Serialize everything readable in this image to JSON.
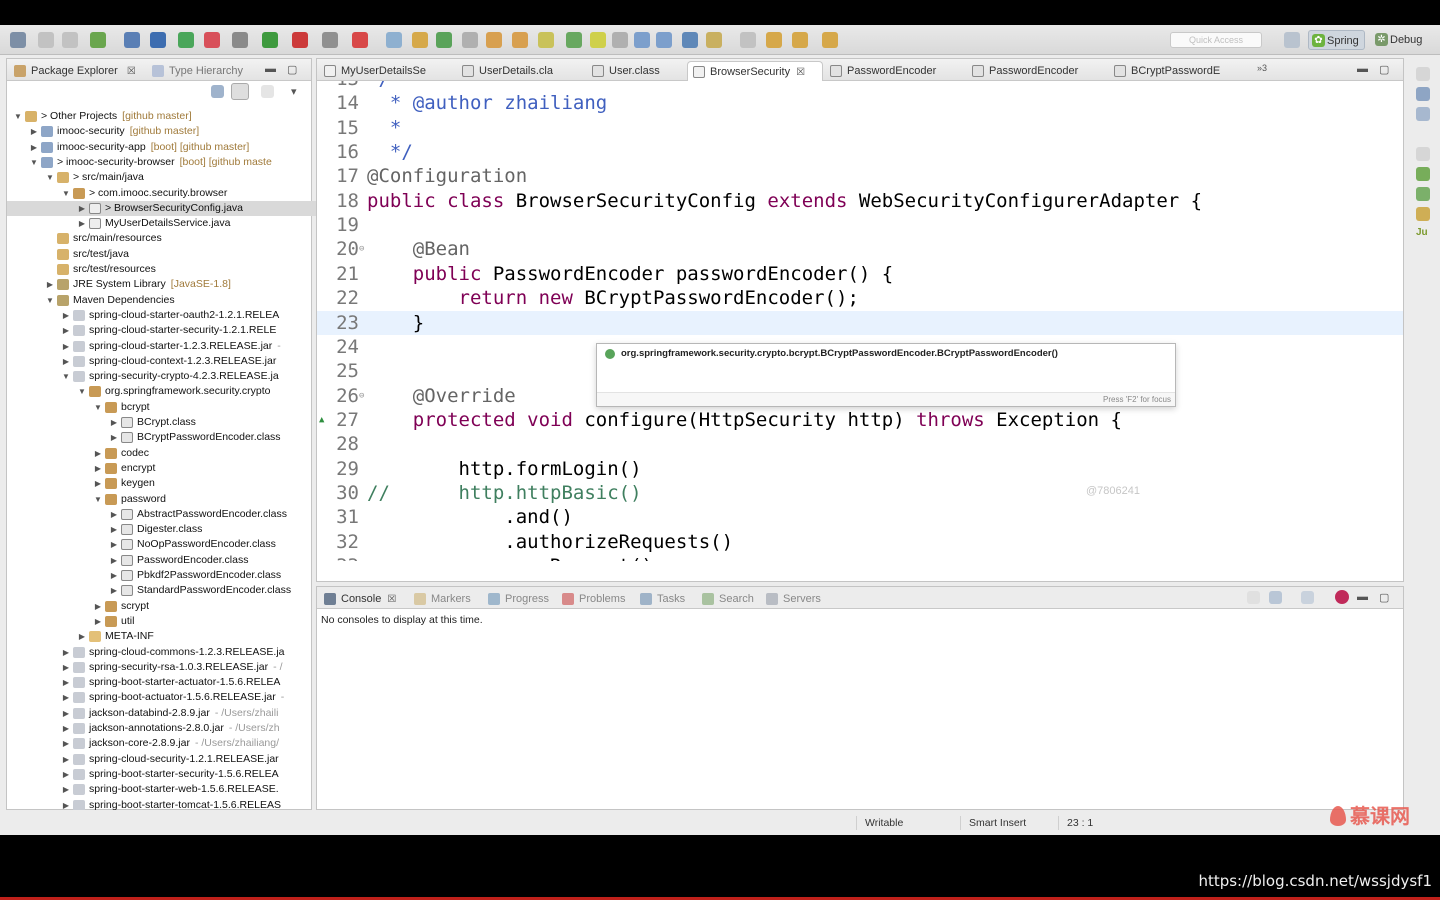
{
  "toolbar": {
    "quick_access_placeholder": "Quick Access",
    "perspectives": [
      {
        "label": "Spring",
        "icon": "spring-leaf-icon",
        "active": true
      },
      {
        "label": "Debug",
        "icon": "bug-icon",
        "active": false
      }
    ]
  },
  "explorer": {
    "tabs": [
      {
        "label": "Package Explorer",
        "active": true
      },
      {
        "label": "Type Hierarchy",
        "active": false
      }
    ],
    "tree": [
      {
        "depth": 0,
        "arrow": "open",
        "icon": "folder-set-icon",
        "label": "> Other Projects",
        "deco": "[github master]"
      },
      {
        "depth": 1,
        "arrow": "closed",
        "icon": "project-icon",
        "label": "imooc-security",
        "deco": "[github master]"
      },
      {
        "depth": 1,
        "arrow": "closed",
        "icon": "project-icon",
        "label": "imooc-security-app",
        "deco": "[boot] [github master]"
      },
      {
        "depth": 1,
        "arrow": "open",
        "icon": "project-icon",
        "label": "> imooc-security-browser",
        "deco": "[boot] [github maste"
      },
      {
        "depth": 2,
        "arrow": "open",
        "icon": "source-folder-icon",
        "label": "> src/main/java",
        "deco": ""
      },
      {
        "depth": 3,
        "arrow": "open",
        "icon": "package-icon",
        "label": "> com.imooc.security.browser",
        "deco": ""
      },
      {
        "depth": 4,
        "arrow": "closed",
        "icon": "java-file-icon",
        "label": "> BrowserSecurityConfig.java",
        "deco": "",
        "selected": true
      },
      {
        "depth": 4,
        "arrow": "closed",
        "icon": "java-file-icon",
        "label": "MyUserDetailsService.java",
        "deco": ""
      },
      {
        "depth": 2,
        "arrow": "none",
        "icon": "source-folder-icon",
        "label": "src/main/resources",
        "deco": ""
      },
      {
        "depth": 2,
        "arrow": "none",
        "icon": "source-folder-icon",
        "label": "src/test/java",
        "deco": ""
      },
      {
        "depth": 2,
        "arrow": "none",
        "icon": "source-folder-icon",
        "label": "src/test/resources",
        "deco": ""
      },
      {
        "depth": 2,
        "arrow": "closed",
        "icon": "library-icon",
        "label": "JRE System Library",
        "deco": "[JavaSE-1.8]"
      },
      {
        "depth": 2,
        "arrow": "open",
        "icon": "library-icon",
        "label": "Maven Dependencies",
        "deco": ""
      },
      {
        "depth": 3,
        "arrow": "closed",
        "icon": "jar-icon",
        "label": "spring-cloud-starter-oauth2-1.2.1.RELEA",
        "deco": ""
      },
      {
        "depth": 3,
        "arrow": "closed",
        "icon": "jar-icon",
        "label": "spring-cloud-starter-security-1.2.1.RELE",
        "deco": ""
      },
      {
        "depth": 3,
        "arrow": "closed",
        "icon": "jar-icon",
        "label": "spring-cloud-starter-1.2.3.RELEASE.jar",
        "deco": "-"
      },
      {
        "depth": 3,
        "arrow": "closed",
        "icon": "jar-icon",
        "label": "spring-cloud-context-1.2.3.RELEASE.jar",
        "deco": ""
      },
      {
        "depth": 3,
        "arrow": "open",
        "icon": "jar-icon",
        "label": "spring-security-crypto-4.2.3.RELEASE.ja",
        "deco": ""
      },
      {
        "depth": 4,
        "arrow": "open",
        "icon": "package-icon",
        "label": "org.springframework.security.crypto",
        "deco": ""
      },
      {
        "depth": 5,
        "arrow": "open",
        "icon": "package-icon",
        "label": "bcrypt",
        "deco": ""
      },
      {
        "depth": 6,
        "arrow": "closed",
        "icon": "class-file-icon",
        "label": "BCrypt.class",
        "deco": ""
      },
      {
        "depth": 6,
        "arrow": "closed",
        "icon": "class-file-icon",
        "label": "BCryptPasswordEncoder.class",
        "deco": ""
      },
      {
        "depth": 5,
        "arrow": "closed",
        "icon": "package-icon",
        "label": "codec",
        "deco": ""
      },
      {
        "depth": 5,
        "arrow": "closed",
        "icon": "package-icon",
        "label": "encrypt",
        "deco": ""
      },
      {
        "depth": 5,
        "arrow": "closed",
        "icon": "package-icon",
        "label": "keygen",
        "deco": ""
      },
      {
        "depth": 5,
        "arrow": "open",
        "icon": "package-icon",
        "label": "password",
        "deco": ""
      },
      {
        "depth": 6,
        "arrow": "closed",
        "icon": "class-file-icon",
        "label": "AbstractPasswordEncoder.class",
        "deco": ""
      },
      {
        "depth": 6,
        "arrow": "closed",
        "icon": "class-file-icon",
        "label": "Digester.class",
        "deco": ""
      },
      {
        "depth": 6,
        "arrow": "closed",
        "icon": "class-file-icon",
        "label": "NoOpPasswordEncoder.class",
        "deco": ""
      },
      {
        "depth": 6,
        "arrow": "closed",
        "icon": "class-file-icon",
        "label": "PasswordEncoder.class",
        "deco": ""
      },
      {
        "depth": 6,
        "arrow": "closed",
        "icon": "class-file-icon",
        "label": "Pbkdf2PasswordEncoder.class",
        "deco": ""
      },
      {
        "depth": 6,
        "arrow": "closed",
        "icon": "class-file-icon",
        "label": "StandardPasswordEncoder.class",
        "deco": ""
      },
      {
        "depth": 5,
        "arrow": "closed",
        "icon": "package-icon",
        "label": "scrypt",
        "deco": ""
      },
      {
        "depth": 5,
        "arrow": "closed",
        "icon": "package-icon",
        "label": "util",
        "deco": ""
      },
      {
        "depth": 4,
        "arrow": "closed",
        "icon": "folder-icon",
        "label": "META-INF",
        "deco": ""
      },
      {
        "depth": 3,
        "arrow": "closed",
        "icon": "jar-icon",
        "label": "spring-cloud-commons-1.2.3.RELEASE.ja",
        "deco": ""
      },
      {
        "depth": 3,
        "arrow": "closed",
        "icon": "jar-icon",
        "label": "spring-security-rsa-1.0.3.RELEASE.jar",
        "deco": "- /"
      },
      {
        "depth": 3,
        "arrow": "closed",
        "icon": "jar-icon",
        "label": "spring-boot-starter-actuator-1.5.6.RELEA",
        "deco": ""
      },
      {
        "depth": 3,
        "arrow": "closed",
        "icon": "jar-icon",
        "label": "spring-boot-actuator-1.5.6.RELEASE.jar",
        "deco": "-"
      },
      {
        "depth": 3,
        "arrow": "closed",
        "icon": "jar-icon",
        "label": "jackson-databind-2.8.9.jar",
        "deco": "- /Users/zhaili"
      },
      {
        "depth": 3,
        "arrow": "closed",
        "icon": "jar-icon",
        "label": "jackson-annotations-2.8.0.jar",
        "deco": "- /Users/zh"
      },
      {
        "depth": 3,
        "arrow": "closed",
        "icon": "jar-icon",
        "label": "jackson-core-2.8.9.jar",
        "deco": "- /Users/zhailiang/"
      },
      {
        "depth": 3,
        "arrow": "closed",
        "icon": "jar-icon",
        "label": "spring-cloud-security-1.2.1.RELEASE.jar",
        "deco": ""
      },
      {
        "depth": 3,
        "arrow": "closed",
        "icon": "jar-icon",
        "label": "spring-boot-starter-security-1.5.6.RELEA",
        "deco": ""
      },
      {
        "depth": 3,
        "arrow": "closed",
        "icon": "jar-icon",
        "label": "spring-boot-starter-web-1.5.6.RELEASE.",
        "deco": ""
      },
      {
        "depth": 3,
        "arrow": "closed",
        "icon": "jar-icon",
        "label": "spring-boot-starter-tomcat-1.5.6.RELEAS",
        "deco": ""
      }
    ]
  },
  "editor": {
    "tabs": [
      {
        "label": "MyUserDetailsSe",
        "icon": "java-file-icon",
        "active": false
      },
      {
        "label": "UserDetails.cla",
        "icon": "class-file-icon",
        "active": false
      },
      {
        "label": "User.class",
        "icon": "class-file-icon",
        "active": false
      },
      {
        "label": "BrowserSecurity",
        "icon": "java-file-icon",
        "active": true
      },
      {
        "label": "PasswordEncoder",
        "icon": "class-file-icon",
        "active": false
      },
      {
        "label": "PasswordEncoder",
        "icon": "class-file-icon",
        "active": false
      },
      {
        "label": "BCryptPasswordE",
        "icon": "class-file-icon",
        "active": false
      }
    ],
    "overflow_label": "»3",
    "lines": [
      {
        "num": "13",
        "segments": [
          {
            "t": " /**",
            "c": "jd"
          }
        ],
        "fold": true
      },
      {
        "num": "14",
        "segments": [
          {
            "t": "  * @author zhailiang",
            "c": "jd"
          }
        ]
      },
      {
        "num": "15",
        "segments": [
          {
            "t": "  *",
            "c": "jd"
          }
        ]
      },
      {
        "num": "16",
        "segments": [
          {
            "t": "  */",
            "c": "jd"
          }
        ]
      },
      {
        "num": "17",
        "segments": [
          {
            "t": "@Configuration",
            "c": "ann"
          }
        ]
      },
      {
        "num": "18",
        "segments": [
          {
            "t": "public class ",
            "c": "kw"
          },
          {
            "t": "BrowserSecurityConfig ",
            "c": ""
          },
          {
            "t": "extends ",
            "c": "kw"
          },
          {
            "t": "WebSecurityConfigurerAdapter {",
            "c": ""
          }
        ]
      },
      {
        "num": "19",
        "segments": []
      },
      {
        "num": "20",
        "segments": [
          {
            "t": "    @Bean",
            "c": "ann"
          }
        ],
        "fold": true
      },
      {
        "num": "21",
        "segments": [
          {
            "t": "    public ",
            "c": "kw"
          },
          {
            "t": "PasswordEncoder passwordEncoder() {",
            "c": ""
          }
        ]
      },
      {
        "num": "22",
        "segments": [
          {
            "t": "        return new ",
            "c": "kw"
          },
          {
            "t": "BCryptPasswordEncoder();",
            "c": ""
          }
        ]
      },
      {
        "num": "23",
        "segments": [
          {
            "t": "    }",
            "c": ""
          }
        ],
        "current": true
      },
      {
        "num": "24",
        "segments": []
      },
      {
        "num": "25",
        "segments": []
      },
      {
        "num": "26",
        "segments": [
          {
            "t": "    @Override",
            "c": "ann"
          }
        ],
        "fold": true
      },
      {
        "num": "27",
        "segments": [
          {
            "t": "    protected void ",
            "c": "kw"
          },
          {
            "t": "configure(HttpSecurity http) ",
            "c": ""
          },
          {
            "t": "throws ",
            "c": "kw"
          },
          {
            "t": "Exception {",
            "c": ""
          }
        ],
        "override_marker": true
      },
      {
        "num": "28",
        "segments": []
      },
      {
        "num": "29",
        "segments": [
          {
            "t": "        http.formLogin()",
            "c": ""
          }
        ]
      },
      {
        "num": "30",
        "segments": [
          {
            "t": "//      http.httpBasic()",
            "c": "cmt"
          }
        ]
      },
      {
        "num": "31",
        "segments": [
          {
            "t": "            .and()",
            "c": ""
          }
        ]
      },
      {
        "num": "32",
        "segments": [
          {
            "t": "            .authorizeRequests()",
            "c": ""
          }
        ]
      },
      {
        "num": "33",
        "segments": [
          {
            "t": "            .anyRequest()",
            "c": ""
          }
        ]
      }
    ],
    "autocomplete": {
      "suggestion": "org.springframework.security.crypto.bcrypt.BCryptPasswordEncoder.BCryptPasswordEncoder()",
      "hint": "Press 'F2' for focus"
    },
    "watermark_id": "@7806241"
  },
  "console": {
    "tabs": [
      {
        "label": "Console",
        "icon": "console-icon",
        "active": true
      },
      {
        "label": "Markers",
        "icon": "markers-icon",
        "active": false
      },
      {
        "label": "Progress",
        "icon": "progress-icon",
        "active": false
      },
      {
        "label": "Problems",
        "icon": "problems-icon",
        "active": false
      },
      {
        "label": "Tasks",
        "icon": "tasks-icon",
        "active": false
      },
      {
        "label": "Search",
        "icon": "search-icon",
        "active": false
      },
      {
        "label": "Servers",
        "icon": "servers-icon",
        "active": false
      }
    ],
    "message": "No consoles to display at this time."
  },
  "status": {
    "writable": "Writable",
    "insert_mode": "Smart Insert",
    "position": "23 : 1"
  },
  "overlay": {
    "logo_text": "慕课网",
    "url": "https://blog.csdn.net/wssjdysf1"
  },
  "colors": {
    "keyword": "#7f0055",
    "annotation": "#646464",
    "comment": "#3f7f5f",
    "javadoc": "#3f5fbf",
    "current_line": "#e8f2fe",
    "selection": "#d9d9d9"
  }
}
